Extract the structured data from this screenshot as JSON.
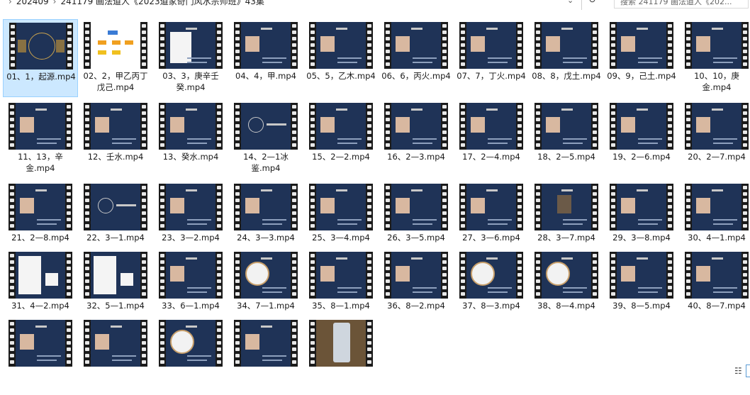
{
  "breadcrumb": [
    "202409",
    "241179 画法道人《2023道家奇门风水宗师班》43集"
  ],
  "search": {
    "placeholder": "搜索 241179 画法道人《202..."
  },
  "colors": {
    "selection": "#cce8ff",
    "selection_border": "#99d1ff",
    "slide_bg": "#1f3357"
  },
  "files": [
    {
      "name": "01、1，起源.mp4",
      "thumb": "title",
      "selected": true
    },
    {
      "name": "02、2，甲乙丙丁戊己.mp4",
      "thumb": "chart"
    },
    {
      "name": "03、3，庚辛壬癸.mp4",
      "thumb": "symbols"
    },
    {
      "name": "04、4，甲.mp4",
      "thumb": "photo-left"
    },
    {
      "name": "05、5，乙木.mp4",
      "thumb": "photo-left"
    },
    {
      "name": "06、6，丙火.mp4",
      "thumb": "photo-left"
    },
    {
      "name": "07、7，丁火.mp4",
      "thumb": "photo-left"
    },
    {
      "name": "08、8，戊土.mp4",
      "thumb": "photo-left"
    },
    {
      "name": "09、9，己土.mp4",
      "thumb": "photo-left"
    },
    {
      "name": "10、10，庚金.mp4",
      "thumb": "photo-left"
    },
    {
      "name": "11、13，辛金.mp4",
      "thumb": "photo-left"
    },
    {
      "name": "12、壬水.mp4",
      "thumb": "photo-left"
    },
    {
      "name": "13、癸水.mp4",
      "thumb": "photo-left"
    },
    {
      "name": "14、2—1冰鉴.mp4",
      "thumb": "circle-title"
    },
    {
      "name": "15、2—2.mp4",
      "thumb": "photo-left"
    },
    {
      "name": "16、2—3.mp4",
      "thumb": "photo-left"
    },
    {
      "name": "17、2—4.mp4",
      "thumb": "photo-left"
    },
    {
      "name": "18、2—5.mp4",
      "thumb": "photo-left"
    },
    {
      "name": "19、2—6.mp4",
      "thumb": "photo-left"
    },
    {
      "name": "20、2—7.mp4",
      "thumb": "photo-left"
    },
    {
      "name": "21、2—8.mp4",
      "thumb": "photo-left"
    },
    {
      "name": "22、3—1.mp4",
      "thumb": "circle-title"
    },
    {
      "name": "23、3—2.mp4",
      "thumb": "photo-left"
    },
    {
      "name": "24、3—3.mp4",
      "thumb": "photo-left"
    },
    {
      "name": "25、3—4.mp4",
      "thumb": "photo-left"
    },
    {
      "name": "26、3—5.mp4",
      "thumb": "photo-left"
    },
    {
      "name": "27、3—6.mp4",
      "thumb": "photo-left"
    },
    {
      "name": "28、3—7.mp4",
      "thumb": "photo-center"
    },
    {
      "name": "29、3—8.mp4",
      "thumb": "photo-left"
    },
    {
      "name": "30、4—1.mp4",
      "thumb": "photo-left"
    },
    {
      "name": "31、4—2.mp4",
      "thumb": "diagram"
    },
    {
      "name": "32、5—1.mp4",
      "thumb": "diagram"
    },
    {
      "name": "33、6—1.mp4",
      "thumb": "photo-left"
    },
    {
      "name": "34、7—1.mp4",
      "thumb": "wheel"
    },
    {
      "name": "35、8—1.mp4",
      "thumb": "photo-left"
    },
    {
      "name": "36、8—2.mp4",
      "thumb": "photo-left"
    },
    {
      "name": "37、8—3.mp4",
      "thumb": "wheel"
    },
    {
      "name": "38、8—4.mp4",
      "thumb": "wheel"
    },
    {
      "name": "39、8—5.mp4",
      "thumb": "photo-left"
    },
    {
      "name": "40、8—7.mp4",
      "thumb": "photo-left"
    },
    {
      "name": "",
      "thumb": "photo-left"
    },
    {
      "name": "",
      "thumb": "photo-left"
    },
    {
      "name": "",
      "thumb": "wheel"
    },
    {
      "name": "",
      "thumb": "photo-left"
    },
    {
      "name": "",
      "thumb": "phone"
    }
  ]
}
